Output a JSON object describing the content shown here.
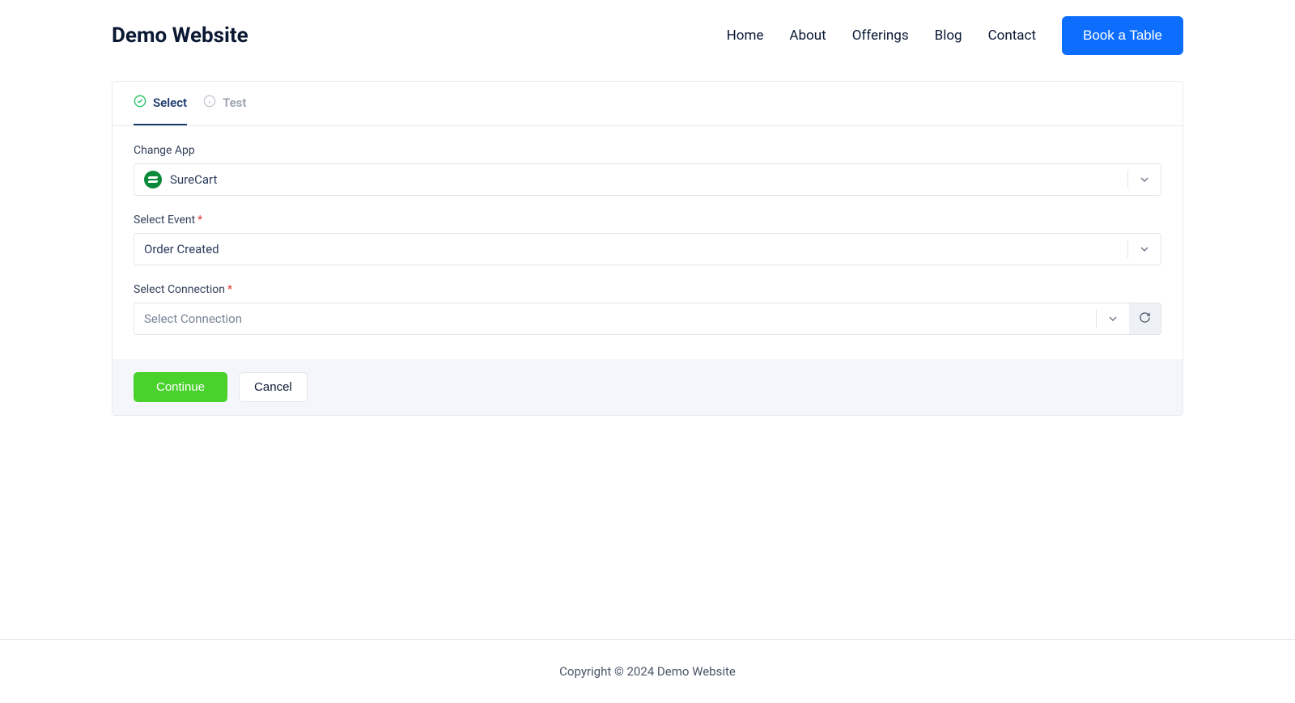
{
  "header": {
    "title": "Demo Website",
    "nav": [
      "Home",
      "About",
      "Offerings",
      "Blog",
      "Contact"
    ],
    "cta": "Book a Table"
  },
  "tabs": {
    "select": "Select",
    "test": "Test"
  },
  "form": {
    "changeApp": {
      "label": "Change App",
      "value": "SureCart"
    },
    "selectEvent": {
      "label": "Select Event",
      "value": "Order Created"
    },
    "selectConnection": {
      "label": "Select Connection",
      "placeholder": "Select Connection"
    }
  },
  "actions": {
    "continue": "Continue",
    "cancel": "Cancel"
  },
  "footer": {
    "copyright": "Copyright © 2024 Demo Website"
  }
}
